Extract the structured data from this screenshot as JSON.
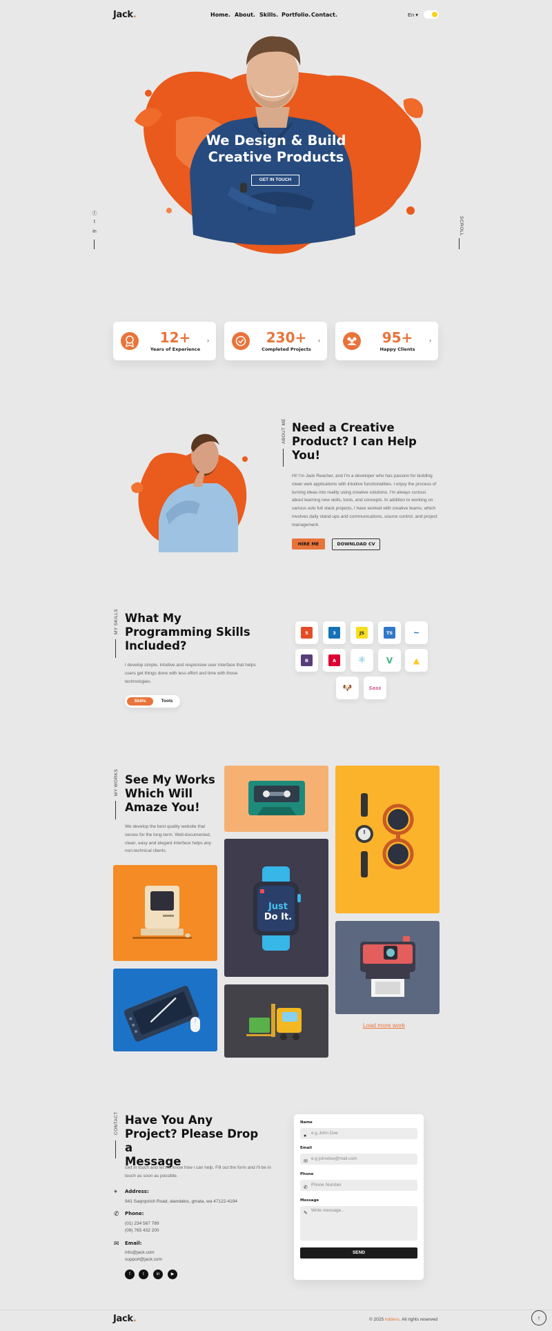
{
  "header": {
    "logo": "Jack",
    "logo_dot": ".",
    "nav": [
      "Home.",
      "About.",
      "Skills.",
      "Portfolio.",
      "Contact."
    ],
    "language": "En",
    "theme_toggle_icon": "sun-toggle-icon"
  },
  "hero": {
    "title_line1": "We Design & Build",
    "title_line2": "Creative Products",
    "cta": "GET IN TOUCH",
    "scroll_label": "SCROLL",
    "social_icons": [
      "facebook-icon",
      "twitter-icon",
      "linkedin-icon"
    ]
  },
  "stats": [
    {
      "value": "12+",
      "label": "Years of Experience",
      "icon": "award-icon"
    },
    {
      "value": "230+",
      "label": "Completed Projects",
      "icon": "check-badge-icon"
    },
    {
      "value": "95+",
      "label": "Happy Clients",
      "icon": "users-icon"
    }
  ],
  "about": {
    "side_label": "ABOUT ME",
    "title_line1": "Need a Creative",
    "title_line2": "Product? I can Help",
    "title_line3": "You!",
    "body": "Hi! I'm Jack Reacher, and I'm a developer who has passion for building clean web applications with intuitive functionalities. I enjoy the process of turning ideas into reality using creative solutions. I'm always curious about learning new skills, tools, and concepts. In addition to working on various solo full stack projects, I have worked with creative teams, which involves daily stand-ups and communications, source control, and project management.",
    "hire_button": "HIRE ME",
    "cv_button": "DOWNLOAD CV"
  },
  "skills": {
    "side_label": "MY SKILLS",
    "title_line1": "What My",
    "title_line2": "Programming Skills",
    "title_line3": "Included?",
    "body": "I develop simple, intuitive and responsive user interface that helps users get things done with less effort and time with those technologies.",
    "tab_skills": "Skills",
    "tab_tools": "Tools",
    "icons": [
      {
        "name": "html5-icon",
        "glyph": "5",
        "color": "#e44d26"
      },
      {
        "name": "css3-icon",
        "glyph": "3",
        "color": "#1572b6"
      },
      {
        "name": "javascript-icon",
        "glyph": "JS",
        "color": "#f7df1e"
      },
      {
        "name": "typescript-icon",
        "glyph": "TS",
        "color": "#3178c6"
      },
      {
        "name": "jquery-icon",
        "glyph": "~",
        "color": "#0769ad"
      },
      {
        "name": "bootstrap-icon",
        "glyph": "B",
        "color": "#563d7c"
      },
      {
        "name": "angular-icon",
        "glyph": "A",
        "color": "#dd0031"
      },
      {
        "name": "react-icon",
        "glyph": "⚛",
        "color": "#61dafb"
      },
      {
        "name": "vue-icon",
        "glyph": "V",
        "color": "#41b883"
      },
      {
        "name": "firebase-icon",
        "glyph": "▲",
        "color": "#ffca28"
      },
      {
        "name": "pug-icon",
        "glyph": "🐶",
        "color": "#a86454"
      },
      {
        "name": "sass-icon",
        "glyph": "Sass",
        "color": "#cc6699"
      }
    ]
  },
  "works": {
    "side_label": "MY WORKS",
    "title_line1": "See My Works",
    "title_line2": "Which Will",
    "title_line3": "Amaze You!",
    "body": "We develop the best quality website that serves for the long-term. Well-documented, clean, easy and elegant interface helps any non-technical clients.",
    "watch_line1": "Just",
    "watch_line2": "Do It.",
    "load_more": "Load more work"
  },
  "contact": {
    "side_label": "CONTACT",
    "title_line1": "Have You Any",
    "title_line2": "Project? Please Drop a",
    "title_line3": "Message",
    "body": "Get in touch and let me know how i can help. Fill out the form and i'll be in touch as soon as possible.",
    "address_label": "Address:",
    "address": "941 Saqrqorish Road, alandalos, gmata, wa 47122-4194",
    "phone_label": "Phone:",
    "phone1": "(01) 234 567 789",
    "phone2": "(09) 765 432 200",
    "email_label": "Email:",
    "email1": "info@jack.com",
    "email2": "support@jack.com",
    "socials": [
      "facebook-icon",
      "twitter-icon",
      "linkedin-icon",
      "youtube-icon"
    ]
  },
  "form": {
    "name_label": "Name",
    "name_placeholder": "e.g John Doe",
    "email_label": "Email",
    "email_placeholder": "e.g johndoe@mail.com",
    "phone_label": "Phone",
    "phone_placeholder": "Phone Number",
    "message_label": "Message",
    "message_placeholder": "Write message...",
    "send": "SEND"
  },
  "footer": {
    "logo": "Jack",
    "copy_prefix": "© 2025",
    "copy_brand": "hddevs",
    "copy_suffix": ". All rights reserved"
  }
}
